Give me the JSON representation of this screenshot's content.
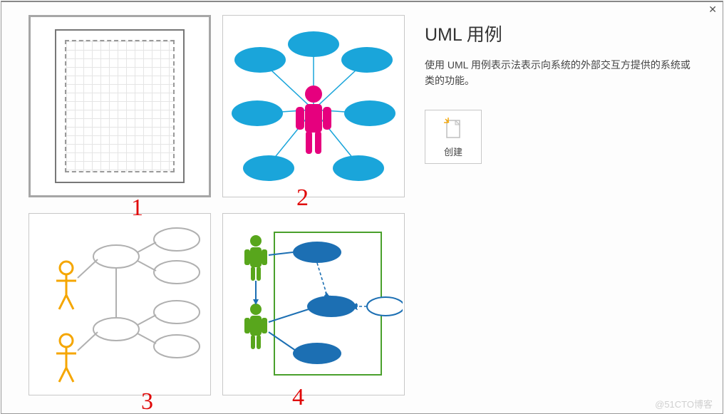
{
  "side": {
    "title": "UML 用例",
    "description": "使用 UML 用例表示法表示向系统的外部交互方提供的系统或类的功能。",
    "create_label": "创建"
  },
  "annotations": {
    "a1": "1",
    "a2": "2",
    "a3": "3",
    "a4": "4"
  },
  "watermark": "@51CTO博客",
  "close_glyph": "✕",
  "templates": {
    "blank": "blank-grid",
    "hub": "usecase-hub",
    "actors": "usecase-actors",
    "system": "usecase-system"
  }
}
